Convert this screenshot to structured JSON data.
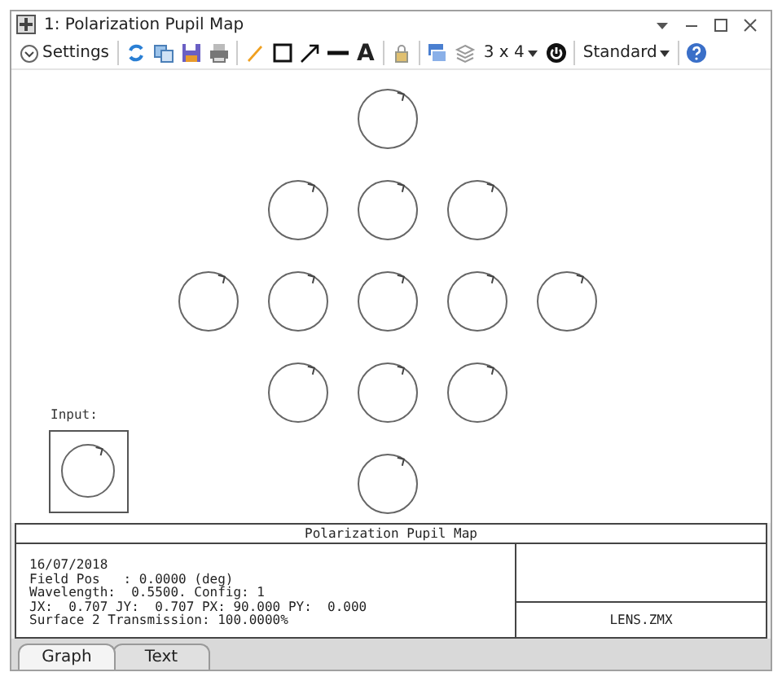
{
  "window": {
    "title": "1: Polarization Pupil Map"
  },
  "toolbar": {
    "settings": "Settings",
    "text_tool": "A",
    "layout_dropdown": "3 x 4",
    "style_dropdown": "Standard"
  },
  "plot": {
    "input_label": "Input:"
  },
  "info": {
    "title": "Polarization Pupil Map",
    "lines": [
      "16/07/2018",
      "Field Pos   : 0.0000 (deg)",
      "Wavelength:  0.5500. Config: 1",
      "JX:  0.707 JY:  0.707 PX: 90.000 PY:  0.000",
      "Surface 2 Transmission: 100.0000%"
    ],
    "file": "LENS.ZMX"
  },
  "tabs": [
    {
      "label": "Graph",
      "selected": true
    },
    {
      "label": "Text",
      "selected": false
    }
  ]
}
